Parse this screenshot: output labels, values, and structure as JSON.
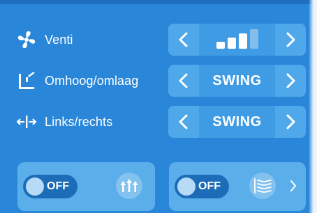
{
  "rows": [
    {
      "label": "Venti",
      "icon": "fan-icon",
      "stepper_type": "fan-speed",
      "level": 3,
      "levels": 4
    },
    {
      "label": "Omhoog/omlaag",
      "icon": "vertical-louver-icon",
      "value": "SWING"
    },
    {
      "label": "Links/rechts",
      "icon": "horizontal-swing-icon",
      "value": "SWING"
    }
  ],
  "cards": [
    {
      "toggle_label": "OFF",
      "button_icon": "arrows-up-icon"
    },
    {
      "toggle_label": "OFF",
      "button_icon": "airflow-icon",
      "chevron": "chevron-right-icon"
    }
  ],
  "colors": {
    "background": "#2a86d9",
    "stepper": "#5ab1ee",
    "card": "#5aaeea",
    "toggle_off": "#1d6cb8"
  }
}
